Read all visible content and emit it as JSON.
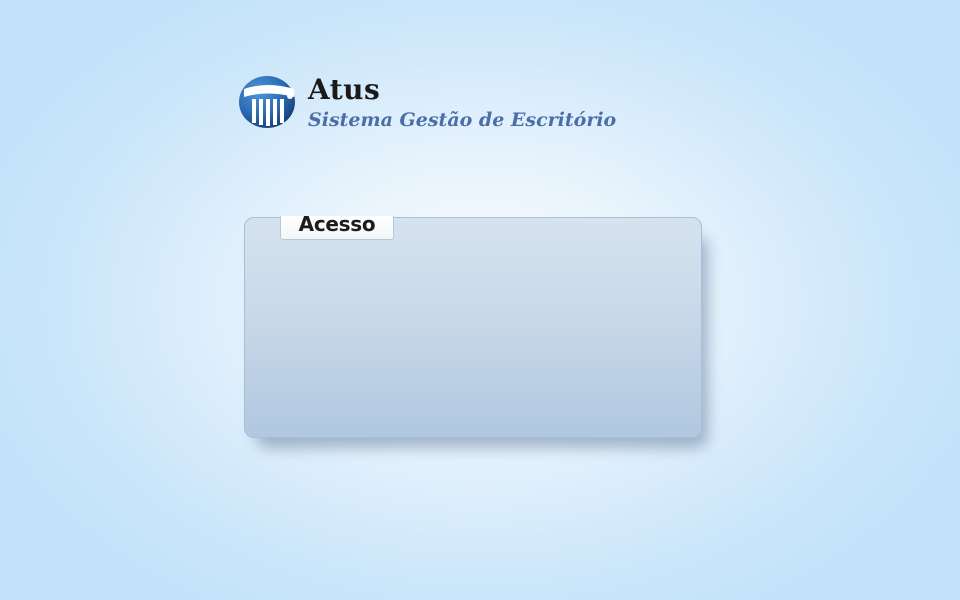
{
  "header": {
    "app_name": "Atus",
    "tagline": "Sistema Gestão de Escritório",
    "logo_icon": "column-pillar-icon"
  },
  "panel": {
    "tab_label": "Acesso"
  },
  "colors": {
    "tagline": "#4a6fa8",
    "logo_blue": "#2a6bb3",
    "panel_top": "#d6e3ef",
    "panel_bottom": "#b0c8e0"
  }
}
